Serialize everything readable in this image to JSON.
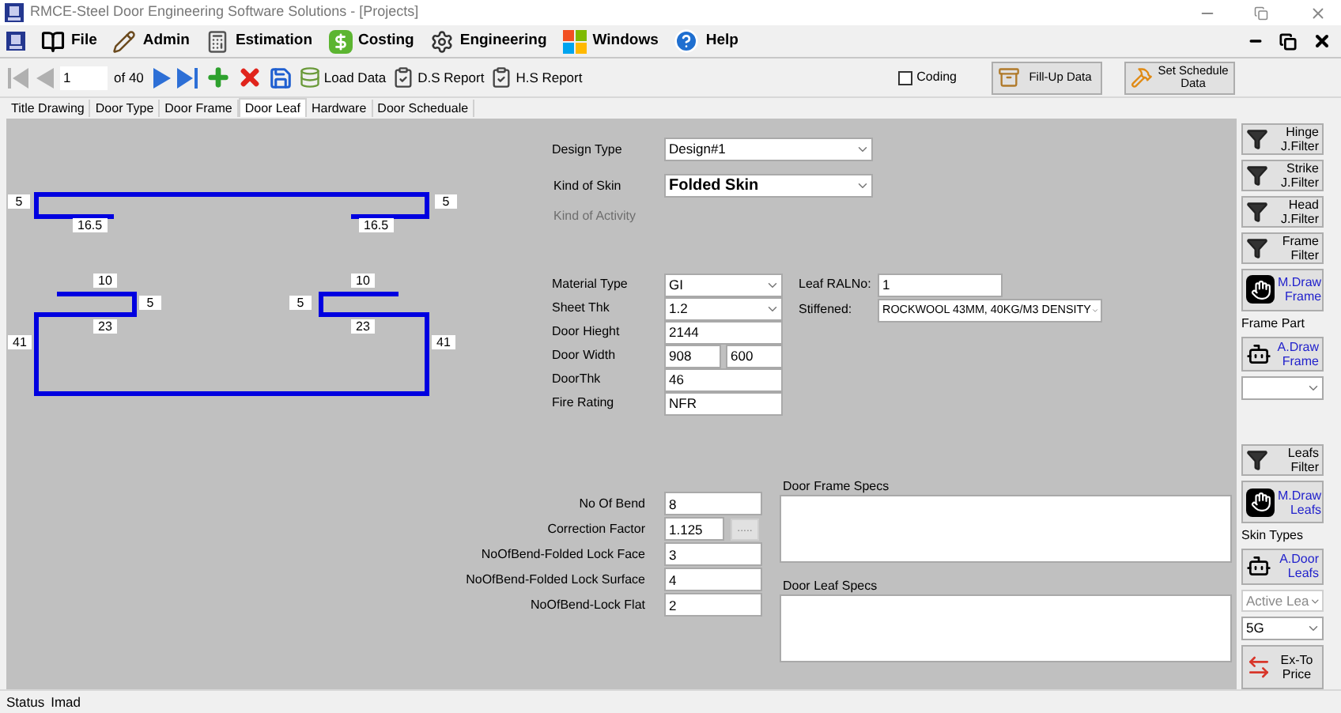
{
  "window": {
    "title": "RMCE-Steel Door Engineering Software Solutions - [Projects]"
  },
  "menu": [
    {
      "label": "File",
      "kind": "book"
    },
    {
      "label": "Admin",
      "kind": "pen"
    },
    {
      "label": "Estimation",
      "kind": "calc"
    },
    {
      "label": "Costing",
      "kind": "dollar"
    },
    {
      "label": "Engineering",
      "kind": "gear"
    },
    {
      "label": "Windows",
      "kind": "squares"
    },
    {
      "label": "Help",
      "kind": "help"
    }
  ],
  "toolbar": {
    "record": "1",
    "of": "of 40",
    "buttons": [
      {
        "label": "Load Data",
        "kind": "load"
      },
      {
        "label": "D.S Report",
        "kind": "report"
      },
      {
        "label": "H.S Report",
        "kind": "report"
      }
    ],
    "coding": {
      "label": "Coding",
      "checked": false
    },
    "actions": [
      {
        "label": "Fill-Up Data",
        "kind": "box"
      },
      {
        "label": "Set Schedule Data",
        "kind": "tools"
      }
    ]
  },
  "tabs": [
    {
      "label": "Title Drawing",
      "selected": false
    },
    {
      "label": "Door Type",
      "selected": false
    },
    {
      "label": "Door Frame",
      "selected": false
    },
    {
      "label": "Door Leaf",
      "selected": true
    },
    {
      "label": "Hardware",
      "selected": false
    },
    {
      "label": "Door Scheduale",
      "selected": false
    }
  ],
  "drawing": {
    "labels": [
      "5",
      "16.5",
      "5",
      "16.5",
      "10",
      "5",
      "23",
      "41",
      "10",
      "5",
      "23",
      "41"
    ]
  },
  "form": {
    "design_type": {
      "label": "Design Type",
      "value": "Design#1"
    },
    "kind_of_skin": {
      "label": "Kind of Skin",
      "value": "Folded Skin"
    },
    "kind_of_activity": {
      "label": "Kind of Activity",
      "disabled": true
    },
    "fields": [
      {
        "label": "Material Type",
        "kind": "select",
        "values": [
          "GI"
        ]
      },
      {
        "label": "Sheet Thk",
        "kind": "select",
        "values": [
          "1.2"
        ]
      },
      {
        "label": "Door Hieght",
        "kind": "input",
        "values": [
          "2144"
        ]
      },
      {
        "label": "Door Width",
        "kind": "input",
        "values": [
          "908",
          "600"
        ]
      },
      {
        "label": "DoorThk",
        "kind": "input",
        "values": [
          "46"
        ]
      },
      {
        "label": "Fire Rating",
        "kind": "input",
        "values": [
          "NFR"
        ]
      }
    ],
    "leaf_ral": {
      "label": "Leaf RALNo:",
      "value": "1"
    },
    "stiffened": {
      "label": "Stiffened:",
      "value": "ROCKWOOL 43MM, 40KG/M3 DENSITY"
    },
    "bends": [
      {
        "label": "No Of Bend",
        "value": "8"
      },
      {
        "label": "Correction Factor",
        "value": "1.125",
        "button": "....."
      },
      {
        "label": "NoOfBend-Folded Lock Face",
        "value": "3"
      },
      {
        "label": "NoOfBend-Folded Lock Surface",
        "value": "4"
      },
      {
        "label": "NoOfBend-Lock Flat",
        "value": "2"
      }
    ],
    "specs": [
      {
        "label": "Door Frame Specs"
      },
      {
        "label": "Door Leaf Specs"
      }
    ]
  },
  "sidebar": {
    "frame_tools": [
      {
        "kind": "filter",
        "label": "Hinge J.Filter"
      },
      {
        "kind": "filter",
        "label": "Strike J.Filter"
      },
      {
        "kind": "filter",
        "label": "Head J.Filter"
      },
      {
        "kind": "filter",
        "label": "Frame Filter"
      },
      {
        "kind": "hand",
        "label": "M.Draw Frame"
      },
      {
        "kind": "caption",
        "label": "Frame Part"
      },
      {
        "kind": "robot",
        "label": "A.Draw Frame"
      },
      {
        "kind": "select",
        "disabled": false
      }
    ],
    "leaf_tools": [
      {
        "kind": "filter",
        "label": "Leafs Filter"
      },
      {
        "kind": "hand",
        "label": "M.Draw Leafs"
      },
      {
        "kind": "caption",
        "label": "Skin Types"
      },
      {
        "kind": "robot",
        "label": "A.Door Leafs"
      },
      {
        "kind": "select",
        "label": "Active Lea",
        "disabled": true
      },
      {
        "kind": "select",
        "label": "5G",
        "disabled": false
      },
      {
        "kind": "price",
        "label": "Ex-To Price"
      }
    ]
  },
  "status_bar": [
    "Status",
    "Imad"
  ]
}
